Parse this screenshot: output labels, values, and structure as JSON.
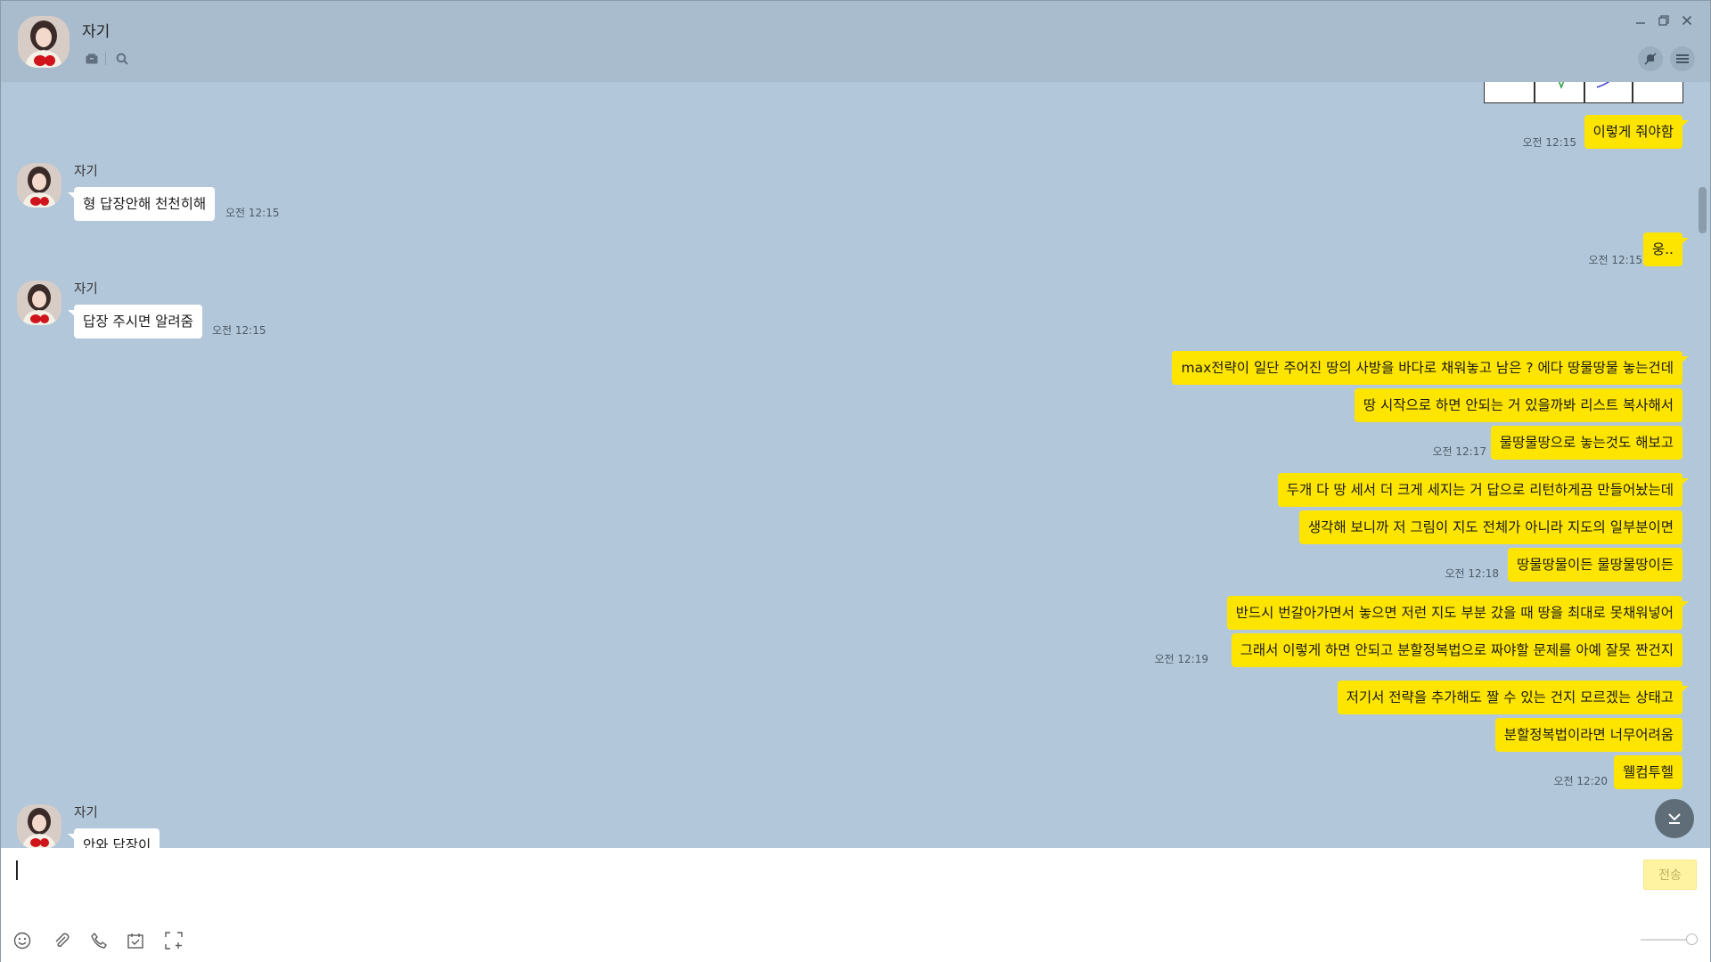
{
  "header": {
    "name": "자기"
  },
  "chat": {
    "first_mine": [
      {
        "text": "이렇게 줘야함",
        "time": "오전 12:15"
      }
    ],
    "theirs1": {
      "sender": "자기",
      "text": "형 답장안해 천천히해",
      "time": "오전 12:15"
    },
    "mine2": {
      "text": "웅..",
      "time": "오전 12:15"
    },
    "theirs2": {
      "sender": "자기",
      "text": "답장 주시면 알려줌",
      "time": "오전 12:15"
    },
    "group1": [
      "max전략이 일단 주어진 땅의 사방을 바다로 채워놓고 남은 ? 에다 땅물땅물 놓는건데",
      "땅 시작으로 하면 안되는 거 있을까봐 리스트 복사해서",
      "물땅물땅으로 놓는것도 해보고"
    ],
    "group1_time": "오전 12:17",
    "group2": [
      "두개 다 땅 세서 더 크게 세지는 거 답으로 리턴하게끔 만들어놨는데",
      "생각해 보니까 저 그림이 지도 전체가 아니라 지도의 일부분이면",
      "땅물땅물이든 물땅물땅이든"
    ],
    "group2_time": "오전 12:18",
    "group3": [
      "반드시 번갈아가면서 놓으면 저런 지도 부분 갔을 때 땅을 최대로 못채워넣어",
      "그래서 이렇게 하면 안되고 분할정복법으로 짜야할 문제를 아예 잘못 짠건지"
    ],
    "group3_time": "오전 12:19",
    "group4": [
      "저기서 전략을 추가해도 짤 수 있는 건지 모르겠는 상태고",
      "분할정복법이라면 너무어려움",
      "웰컴투헬"
    ],
    "group4_time": "오전 12:20",
    "theirs3": {
      "sender": "자기",
      "text": "안와 답장이"
    }
  },
  "input": {
    "send_label": "전송"
  },
  "colors": {
    "chat_bg": "#b2c7da",
    "my_bubble": "#fee500",
    "their_bubble": "#ffffff",
    "header_bg": "#a9bccd"
  }
}
